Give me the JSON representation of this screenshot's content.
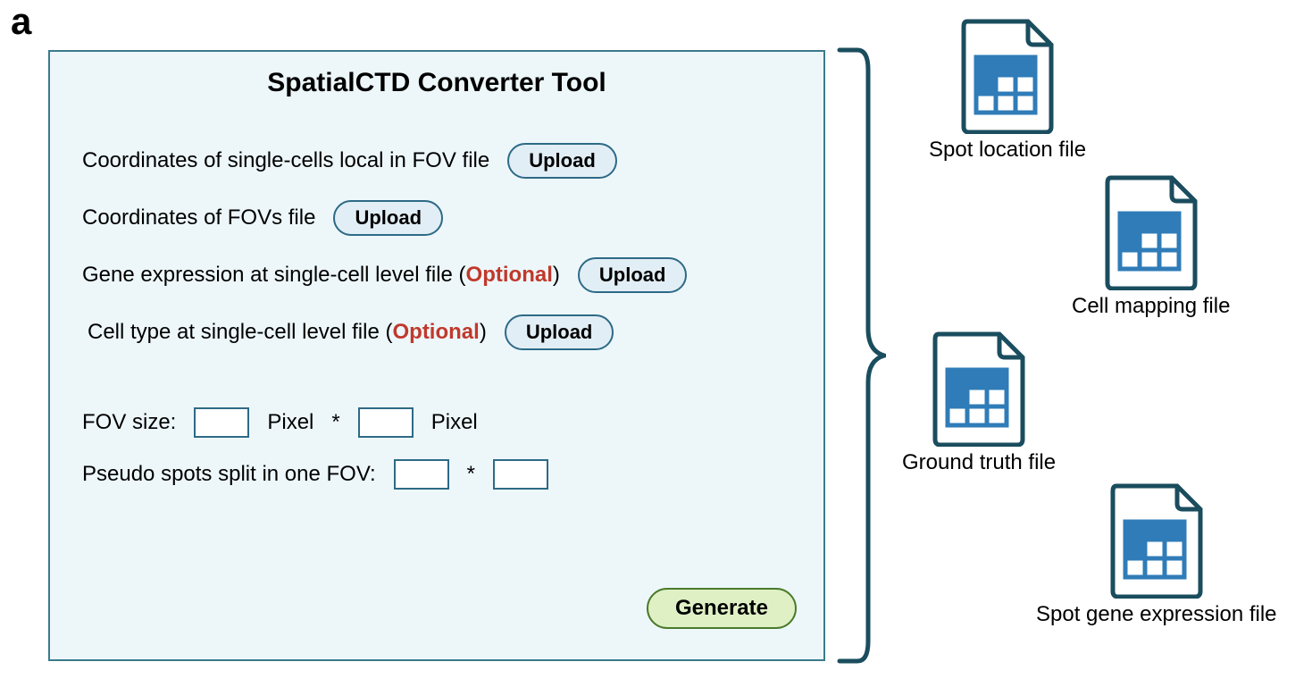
{
  "panel_label": "a",
  "tool": {
    "title": "SpatialCTD Converter Tool",
    "rows": {
      "r1_label": "Coordinates of single-cells local in FOV file",
      "r2_label": "Coordinates of FOVs file",
      "r3_label_pre": "Gene expression at single-cell level file (",
      "r3_label_post": ")",
      "r4_label_pre": "Cell type at single-cell level file (",
      "r4_label_post": ")",
      "optional": "Optional",
      "upload": "Upload",
      "fov_size_label": "FOV size:",
      "pixel": "Pixel",
      "star": "*",
      "pseudo_label": "Pseudo spots split in one FOV:"
    },
    "generate": "Generate"
  },
  "outputs": {
    "o1": "Spot location file",
    "o2": "Cell  mapping file",
    "o3": "Ground truth file",
    "o4": "Spot gene expression file"
  }
}
